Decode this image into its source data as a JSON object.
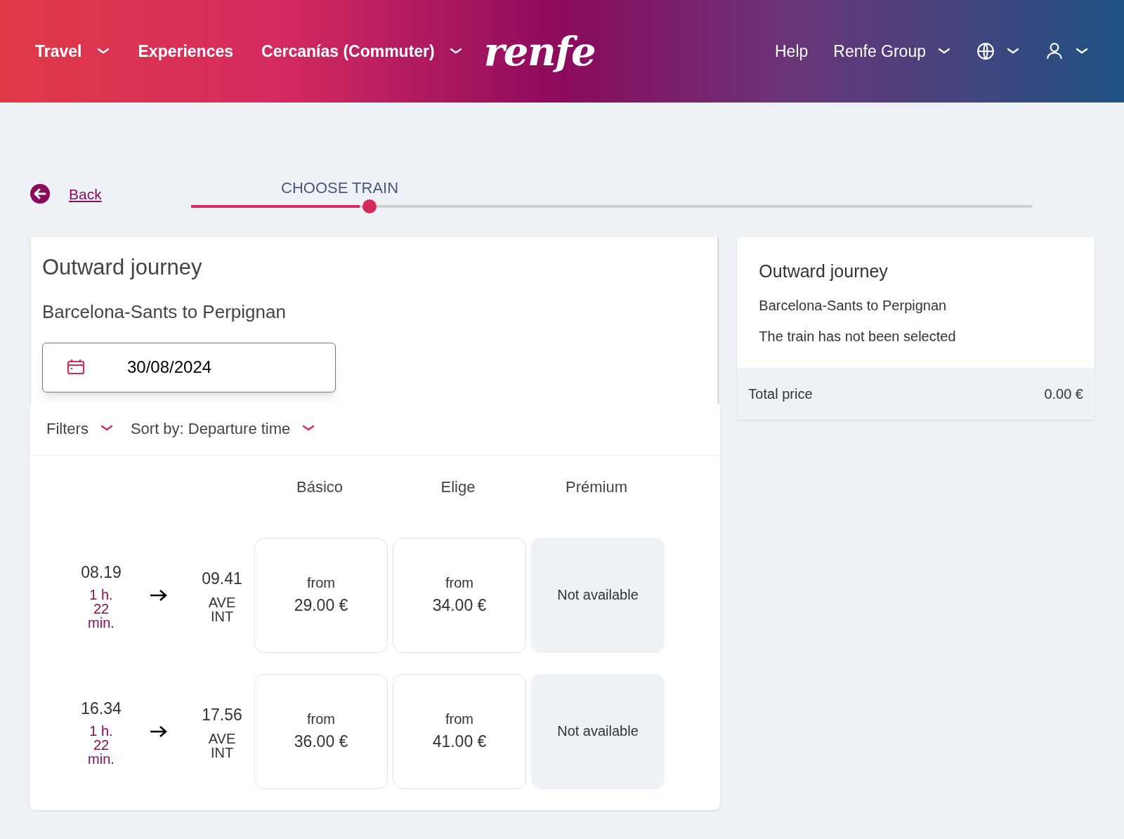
{
  "nav": {
    "left": [
      {
        "label": "Travel",
        "dropdown": true
      },
      {
        "label": "Experiences",
        "dropdown": false
      },
      {
        "label": "Cercanías (Commuter)",
        "dropdown": true
      }
    ],
    "logo": "renfe",
    "right": [
      {
        "kind": "text",
        "label": "Help",
        "dropdown": false
      },
      {
        "kind": "text",
        "label": "Renfe Group",
        "dropdown": true
      },
      {
        "kind": "globe",
        "dropdown": true
      },
      {
        "kind": "user",
        "dropdown": true
      }
    ]
  },
  "back": {
    "label": "Back"
  },
  "stepper": {
    "label": "CHOOSE TRAIN",
    "level": 0.2
  },
  "journey": {
    "title": "Outward journey",
    "route": "Barcelona-Sants to Perpignan",
    "date": "30/08/2024"
  },
  "toolbar": {
    "filters": "Filters",
    "sort": "Sort by: Departure time"
  },
  "fare_columns": [
    "Básico",
    "Elige",
    "Prémium"
  ],
  "trains": [
    {
      "departure": "08.19",
      "duration": "1 h. 22 min.",
      "arrival": "09.41",
      "service": "AVE INT",
      "fares": [
        {
          "kind": "price",
          "label": "from",
          "price": "29.00 €"
        },
        {
          "kind": "price",
          "label": "from",
          "price": "34.00 €"
        },
        {
          "kind": "unavailable",
          "label": "Not available"
        }
      ]
    },
    {
      "departure": "16.34",
      "duration": "1 h. 22 min.",
      "arrival": "17.56",
      "service": "AVE INT",
      "fares": [
        {
          "kind": "price",
          "label": "from",
          "price": "36.00 €"
        },
        {
          "kind": "price",
          "label": "from",
          "price": "41.00 €"
        },
        {
          "kind": "unavailable",
          "label": "Not available"
        }
      ]
    }
  ],
  "summary": {
    "title": "Outward journey",
    "route": "Barcelona-Sants to Perpignan",
    "status": "The train has not been selected",
    "total_label": "Total price",
    "total": "0.00 €"
  }
}
